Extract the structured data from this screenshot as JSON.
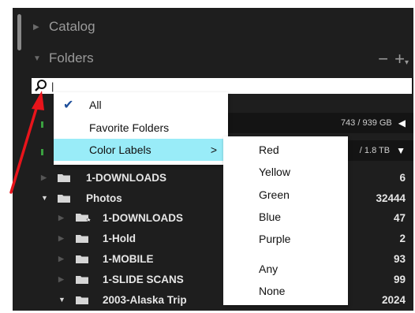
{
  "panel": {
    "catalog_label": "Catalog",
    "folders_label": "Folders",
    "remove_label": "−",
    "add_label": "+",
    "add_menu_mark": "▾"
  },
  "search": {
    "value": "|",
    "placeholder": ""
  },
  "volumes": [
    {
      "usage": "743 / 939 GB",
      "indicator": "◀"
    },
    {
      "usage": "/ 1.8 TB",
      "indicator": "▼"
    }
  ],
  "folders": [
    {
      "name": "1-DOWNLOADS",
      "count": "6"
    },
    {
      "name": "Photos",
      "count": "32444"
    },
    {
      "name": "1-DOWNLOADS",
      "count": "47"
    },
    {
      "name": "1-Hold",
      "count": "2"
    },
    {
      "name": "1-MOBILE",
      "count": "93"
    },
    {
      "name": "1-SLIDE SCANS",
      "count": "99"
    },
    {
      "name": "2003-Alaska Trip",
      "count": "2024"
    }
  ],
  "filter_menu": {
    "items": [
      {
        "label": "All",
        "checked": true
      },
      {
        "label": "Favorite Folders",
        "checked": false
      },
      {
        "label": "Color Labels",
        "checked": false,
        "submenu_arrow": ">"
      }
    ],
    "highlight_color": "#99ecf8"
  },
  "color_labels_submenu": {
    "items": [
      "Red",
      "Yellow",
      "Green",
      "Blue",
      "Purple",
      "Any",
      "None"
    ]
  },
  "colors": {
    "panel_bg": "#1e1e1e",
    "annotation_arrow": "#e8141b",
    "volume_green": "#3aa040"
  }
}
